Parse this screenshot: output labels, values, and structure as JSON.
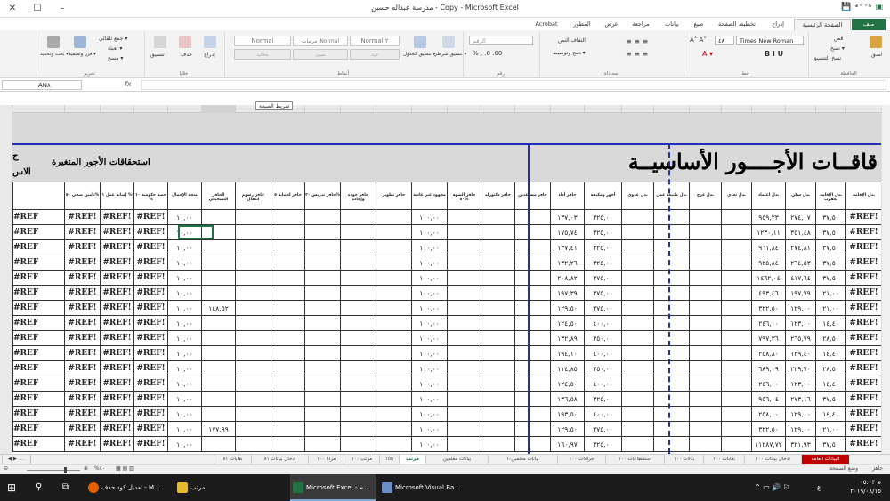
{
  "window": {
    "title": "مدرسة عبداله حسين - Copy  -  Microsoft Excel",
    "minimize": "–",
    "restore": "☐",
    "close": "✕"
  },
  "tabs": [
    {
      "label": "ملف"
    },
    {
      "label": "الصفحة الرئيسية"
    },
    {
      "label": "إدراج"
    },
    {
      "label": "تخطيط الصفحة"
    },
    {
      "label": "صيغ"
    },
    {
      "label": "بيانات"
    },
    {
      "label": "مراجعة"
    },
    {
      "label": "عرض"
    },
    {
      "label": "المطور"
    },
    {
      "label": "Acrobat"
    }
  ],
  "ribbon": {
    "clipboard": {
      "label": "الحافظة",
      "paste": "لصق",
      "cut": "قص",
      "copy": "نسخ ▾",
      "format_painter": "نسخ التنسيق"
    },
    "font": {
      "label": "خط",
      "name": "Times New Roman",
      "size": "٤٨"
    },
    "alignment": {
      "label": "محاذاة",
      "wrap": "التفاف النص",
      "merge": "دمج وتوسيط ▾"
    },
    "number": {
      "label": "رقم",
      "format": "الرقم"
    },
    "styles": {
      "label": "أنماط",
      "conditional": "تنسيق شرطي ▾",
      "as_table": "تنسيق كجدول ▾",
      "normal2": "Normal ٢",
      "normal_sales": "مرتبات_Normal",
      "normal": "Normal",
      "good": "جيد",
      "bad": "سيئ",
      "neutral": "محايد"
    },
    "cells": {
      "label": "خلايا",
      "insert": "إدراج",
      "delete": "حذف",
      "format": "تنسيق"
    },
    "editing": {
      "label": "تحرير",
      "autosum": "جمع تلقائي ▾",
      "fill": "تعبئة ▾",
      "clear": "مسح ▾",
      "sort": "فرز وتصفية ▾",
      "find": "بحث وتحديد ▾"
    }
  },
  "formula_bar": {
    "name_box": "AN٨",
    "fx": "fx",
    "value": ""
  },
  "tooltip": "شريط الصيغة",
  "sheet": {
    "title_right": "قاقــات الأجــــور الأساسيــة",
    "title_left": "استحقاقات الأجور المتغيرة",
    "title_far_left": "ج الاس",
    "headers": [
      "بدل الإقامة",
      "بدل الإقامة بعقرب",
      "بدل سكن",
      "بدل اعتماد",
      "بدل تغذي",
      "بدل غرج",
      "بدل طبيعة عمل",
      "بدل عدوى",
      "أجور ومكيفة",
      "حافز أداء",
      "حافز مساعدين",
      "حافز دكتوراه",
      "حافز الشهة ٥٠%",
      "مجهود غير عادية",
      "حافز تطوير",
      "حافز جودة وإجادة",
      "حافز تدريس ٢٠%",
      "حافز لحماية ٥",
      "حافز رسوم انتقال",
      "الحافز التشجيعي",
      "منحة الإجمال",
      "حصة حكومية ١٠ %",
      "إصابة عمل ١ %",
      "تأمين صحي ٥٠%"
    ],
    "rows": [
      [
        "#REF!",
        "٣٧,٥٠",
        "٢٧٤,٠٧",
        "٩٥٩,٢٣",
        "",
        "",
        "",
        "",
        "٣٢٥,٠٠",
        "١٣٧,٠٣",
        "",
        "",
        "",
        "١٠٠,٠٠",
        "",
        "",
        "",
        "",
        "",
        "",
        "١٠,٠٠",
        "#REF!",
        "#REF!",
        "#REF!"
      ],
      [
        "#REF!",
        "٣٧,٥٠",
        "٣٥١,٤٨",
        "١٢٣٠,١١",
        "",
        "",
        "",
        "",
        "٣٢٥,٠٠",
        "١٧٥,٧٤",
        "",
        "",
        "",
        "١٠٠,٠٠",
        "",
        "",
        "",
        "",
        "",
        "",
        "١٠,٠٠",
        "#REF!",
        "#REF!",
        "#REF!"
      ],
      [
        "#REF!",
        "٣٧,٥٠",
        "٢٧٤,٨١",
        "٩٦١,٨٤",
        "",
        "",
        "",
        "",
        "٣٢٥,٠٠",
        "١٣٧,٤١",
        "",
        "",
        "",
        "١٠٠,٠٠",
        "",
        "",
        "",
        "",
        "",
        "",
        "١٠,٠٠",
        "#REF!",
        "#REF!",
        "#REF!"
      ],
      [
        "#REF!",
        "٣٧,٥٠",
        "٢٦٤,٥٣",
        "٩٢٥,٨٤",
        "",
        "",
        "",
        "",
        "٣٢٥,٠٠",
        "١٣٢,٢٦",
        "",
        "",
        "",
        "١٠٠,٠٠",
        "",
        "",
        "",
        "",
        "",
        "",
        "١٠,٠٠",
        "#REF!",
        "#REF!",
        "#REF!"
      ],
      [
        "#REF!",
        "٣٧,٥٠",
        "٤١٧,٦٤",
        "١٤٦٢,٠٤",
        "",
        "",
        "",
        "",
        "٣٧٥,٠٠",
        "٢٠٨,٨٢",
        "",
        "",
        "",
        "١٠٠,٠٠",
        "",
        "",
        "",
        "",
        "",
        "",
        "١٠,٠٠",
        "#REF!",
        "#REF!",
        "#REF!"
      ],
      [
        "#REF!",
        "٢١,٠٠",
        "١٩٧,٧٩",
        "٤٩٣,٤٦",
        "",
        "",
        "",
        "",
        "٣٧٥,٠٠",
        "١٩٧,٣٩",
        "",
        "",
        "",
        "١٠٠,٠٠",
        "",
        "",
        "",
        "",
        "",
        "",
        "١٠,٠٠",
        "#REF!",
        "#REF!",
        "#REF!"
      ],
      [
        "#REF!",
        "٢١,٠٠",
        "١٢٩,٠٠",
        "٣٢٢,٥٠",
        "",
        "",
        "",
        "",
        "٣٧٥,٠٠",
        "١٢٩,٥٠",
        "",
        "",
        "",
        "١٠٠,٠٠",
        "",
        "",
        "",
        "",
        "",
        "١٤٨,٥٢",
        "١٠,٠٠",
        "#REF!",
        "#REF!",
        "#REF!"
      ],
      [
        "#REF!",
        "١٤,٤٠",
        "١٢٣,٠٠",
        "٢٤٦,٠٠",
        "",
        "",
        "",
        "",
        "٤٠٠,٠٠",
        "١٢٤,٥٠",
        "",
        "",
        "",
        "١٠٠,٠٠",
        "",
        "",
        "",
        "",
        "",
        "",
        "١٠,٠٠",
        "#REF!",
        "#REF!",
        "#REF!"
      ],
      [
        "#REF!",
        "٢٨,٥٠",
        "٢٦٥,٧٩",
        "٧٩٧,٣٦",
        "",
        "",
        "",
        "",
        "٣٥٠,٠٠",
        "١٣٢,٨٩",
        "",
        "",
        "",
        "١٠٠,٠٠",
        "",
        "",
        "",
        "",
        "",
        "",
        "١٠,٠٠",
        "#REF!",
        "#REF!",
        "#REF!"
      ],
      [
        "#REF!",
        "١٤,٤٠",
        "١٢٩,٤٠",
        "٢٥٨,٨٠",
        "",
        "",
        "",
        "",
        "٤٠٠,٠٠",
        "١٩٤,١٠",
        "",
        "",
        "",
        "١٠٠,٠٠",
        "",
        "",
        "",
        "",
        "",
        "",
        "١٠,٠٠",
        "#REF!",
        "#REF!",
        "#REF!"
      ],
      [
        "#REF!",
        "٢٨,٥٠",
        "٢٢٩,٧٠",
        "٦٨٩,٠٩",
        "",
        "",
        "",
        "",
        "٣٥٠,٠٠",
        "١١٤,٨٥",
        "",
        "",
        "",
        "١٠٠,٠٠",
        "",
        "",
        "",
        "",
        "",
        "",
        "١٠,٠٠",
        "#REF!",
        "#REF!",
        "#REF!"
      ],
      [
        "#REF!",
        "١٤,٤٠",
        "١٢٣,٠٠",
        "٢٤٦,٠٠",
        "",
        "",
        "",
        "",
        "٤٠٠,٠٠",
        "١٢٤,٥٠",
        "",
        "",
        "",
        "١٠٠,٠٠",
        "",
        "",
        "",
        "",
        "",
        "",
        "١٠,٠٠",
        "#REF!",
        "#REF!",
        "#REF!"
      ],
      [
        "#REF!",
        "٣٧,٥٠",
        "٢٧٣,١٦",
        "٩٥٦,٠٤",
        "",
        "",
        "",
        "",
        "٣٢٥,٠٠",
        "١٣٦,٥٨",
        "",
        "",
        "",
        "١٠٠,٠٠",
        "",
        "",
        "",
        "",
        "",
        "",
        "١٠,٠٠",
        "#REF!",
        "#REF!",
        "#REF!"
      ],
      [
        "#REF!",
        "١٤,٤٠",
        "١٢٩,٠٠",
        "٢٥٨,٠٠",
        "",
        "",
        "",
        "",
        "٤٠٠,٠٠",
        "١٩٣,٥٠",
        "",
        "",
        "",
        "١٠٠,٠٠",
        "",
        "",
        "",
        "",
        "",
        "",
        "١٠,٠٠",
        "#REF!",
        "#REF!",
        "#REF!"
      ],
      [
        "#REF!",
        "٢١,٠٠",
        "١٢٩,٠٠",
        "٣٢٢,٥٠",
        "",
        "",
        "",
        "",
        "٣٧٥,٠٠",
        "١٢٩,٥٠",
        "",
        "",
        "",
        "١٠٠,٠٠",
        "",
        "",
        "",
        "",
        "",
        "١٧٧,٩٩",
        "١٠,٠٠",
        "#REF!",
        "#REF!",
        "#REF!"
      ],
      [
        "#REF!",
        "٣٧,٥٠",
        "٣٢١,٩٣",
        "١١٢٨٧,٧٢",
        "",
        "",
        "",
        "",
        "٣٢٥,٠٠",
        "١٦٠,٩٧",
        "",
        "",
        "",
        "١٠٠,٠٠",
        "",
        "",
        "",
        "",
        "",
        "",
        "١٠,٠٠",
        "#REF!",
        "#REF!",
        "#REF!"
      ]
    ]
  },
  "sheet_tabs": [
    "البيانات العامة",
    "ادخال بيانات ١٠٠",
    "نقابات ١٠٠",
    "بدلات ١٠٠",
    "استقطاعات ١٠٠",
    "جزاءات ١٠٠",
    "بيانات معلمين-١",
    "بيانات معلمين",
    "مرتب",
    "١٥٥",
    "مرتب ١٠٠",
    "مزايا ١٠٠",
    "ادخال بيانات ٨١",
    "نقابات ٨١"
  ],
  "statusbar": {
    "ready": "جاهز",
    "page_mode": "وضع الصفحة",
    "zoom": "%٤٠"
  },
  "taskbar": {
    "items": [
      "تعديل كود حذف - M...",
      "مرتب",
      "Microsoft Excel - م...",
      "Microsoft Visual Ba..."
    ],
    "time": "م ٠٥:٠٣",
    "date": "٢٠١٩/٠٨/١٥",
    "lang": "ع"
  }
}
